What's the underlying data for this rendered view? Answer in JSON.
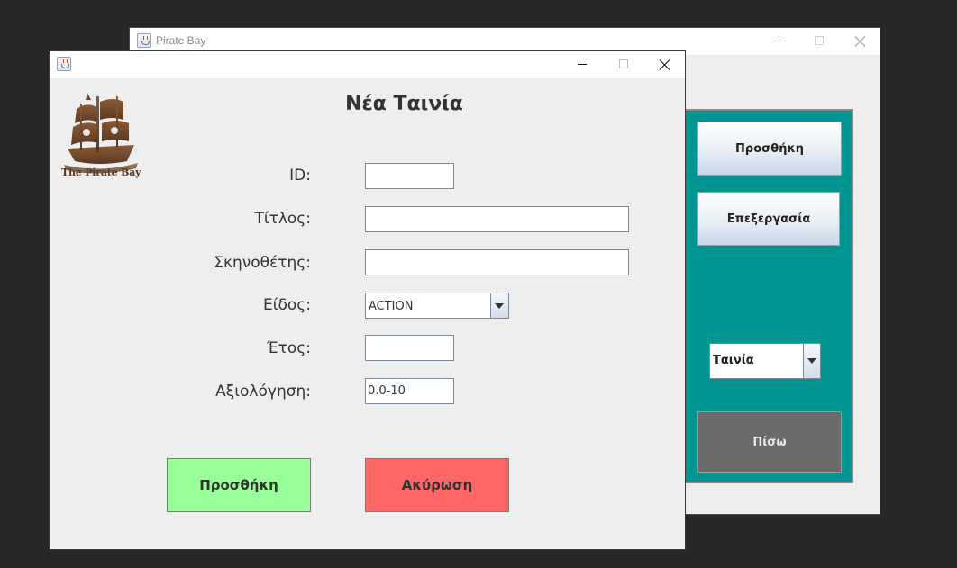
{
  "back_window": {
    "title": "Pirate Bay",
    "side_buttons": {
      "add_label": "Προσθήκη",
      "edit_label": "Επεξεργασία",
      "back_label": "Πίσω"
    },
    "type_combo": {
      "selected": "Ταινία"
    }
  },
  "dialog": {
    "title": "",
    "heading": "Νέα Ταινία",
    "logo_text": "The Pirate Bay",
    "fields": {
      "id_label": "ID:",
      "id_value": "",
      "title_label": "Τίτλος:",
      "title_value": "",
      "director_label": "Σκηνοθέτης:",
      "director_value": "",
      "genre_label": "Είδος:",
      "genre_selected": "ACTION",
      "year_label": "Έτος:",
      "year_value": "",
      "rating_label": "Αξιολόγηση:",
      "rating_value": "0.0-10"
    },
    "buttons": {
      "add_label": "Προσθήκη",
      "cancel_label": "Ακύρωση"
    }
  },
  "colors": {
    "teal_panel": "#009591",
    "add_green": "#99ff99",
    "cancel_red": "#ff6666",
    "back_gray": "#6a6a6a"
  },
  "icons": [
    "java-app-icon",
    "minimize-icon",
    "maximize-icon",
    "close-icon",
    "pirate-ship-logo",
    "chevron-down-icon"
  ]
}
